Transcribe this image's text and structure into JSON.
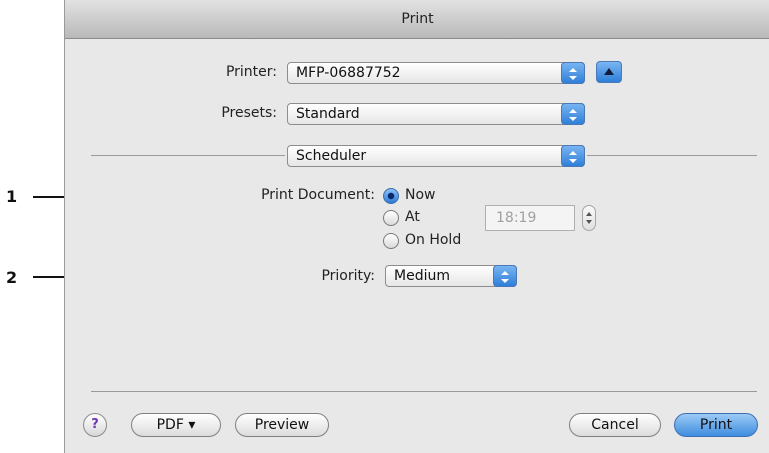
{
  "callouts": [
    "1",
    "2"
  ],
  "dialog": {
    "title": "Print",
    "printer_label": "Printer:",
    "printer_value": "MFP-06887752",
    "presets_label": "Presets:",
    "presets_value": "Standard",
    "panel_value": "Scheduler",
    "print_document_label": "Print Document:",
    "radio_options": [
      {
        "label": "Now",
        "selected": true
      },
      {
        "label": "At",
        "selected": false
      },
      {
        "label": "On Hold",
        "selected": false
      }
    ],
    "time_value": "18:19",
    "priority_label": "Priority:",
    "priority_value": "Medium",
    "buttons": {
      "help": "?",
      "pdf": "PDF ▾",
      "preview": "Preview",
      "cancel": "Cancel",
      "print": "Print"
    }
  },
  "colors": {
    "accent": "#3f8de0",
    "window_bg": "#e8e8e8"
  },
  "icons": [
    "popup-arrows-icon",
    "disclosure-triangle-icon",
    "stepper-arrows-icon",
    "help-icon"
  ]
}
